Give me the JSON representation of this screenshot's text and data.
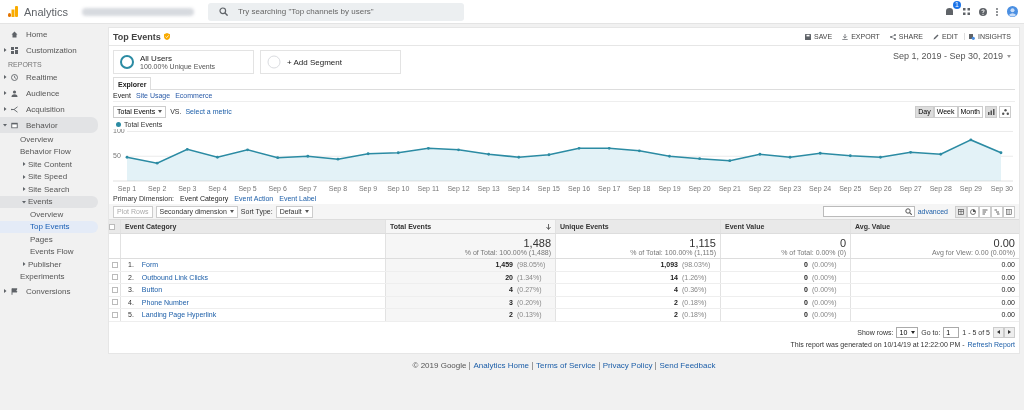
{
  "app": {
    "name": "Analytics",
    "search_placeholder": "Try searching \"Top channels by users\"",
    "notification_count": "1"
  },
  "sidebar": {
    "top_items": [
      {
        "label": "Home",
        "selected": false
      },
      {
        "label": "Customization",
        "selected": false,
        "expanded": false
      }
    ],
    "section_label": "REPORTS",
    "items": [
      {
        "label": "Realtime",
        "selected": false,
        "expanded": false
      },
      {
        "label": "Audience",
        "selected": false,
        "expanded": false
      },
      {
        "label": "Acquisition",
        "selected": false,
        "expanded": false
      },
      {
        "label": "Behavior",
        "selected": false,
        "expanded": true,
        "children": [
          {
            "label": "Overview",
            "selected": false
          },
          {
            "label": "Behavior Flow",
            "selected": false
          },
          {
            "label": "Site Content",
            "selected": false,
            "expanded": false
          },
          {
            "label": "Site Speed",
            "selected": false,
            "expanded": false
          },
          {
            "label": "Site Search",
            "selected": false,
            "expanded": false
          },
          {
            "label": "Events",
            "selected": false,
            "expanded": true,
            "children": [
              {
                "label": "Overview",
                "selected": false
              },
              {
                "label": "Top Events",
                "selected": true
              },
              {
                "label": "Pages",
                "selected": false
              },
              {
                "label": "Events Flow",
                "selected": false
              }
            ]
          },
          {
            "label": "Publisher",
            "selected": false,
            "expanded": false
          },
          {
            "label": "Experiments",
            "selected": false
          }
        ]
      },
      {
        "label": "Conversions",
        "selected": false,
        "expanded": false
      }
    ]
  },
  "report": {
    "title": "Top Events",
    "actions": [
      "SAVE",
      "EXPORT",
      "SHARE",
      "EDIT",
      "INSIGHTS"
    ],
    "date_range": "Sep 1, 2019 - Sep 30, 2019"
  },
  "segments": [
    {
      "name": "All Users",
      "detail": "100.00% Unique Events",
      "active": true
    },
    {
      "name": "+ Add Segment",
      "active": false
    }
  ],
  "tabs": [
    {
      "label": "Explorer",
      "selected": true
    }
  ],
  "subtabs": [
    {
      "label": "Event",
      "selected": true
    },
    {
      "label": "Site Usage",
      "selected": false
    },
    {
      "label": "Ecommerce",
      "selected": false
    }
  ],
  "chart_controls": {
    "metric": "Total Events",
    "vs": "VS.",
    "select_metric": "Select a metric",
    "periods": [
      {
        "label": "Day",
        "selected": true
      },
      {
        "label": "Week",
        "selected": false
      },
      {
        "label": "Month",
        "selected": false
      }
    ]
  },
  "chart": {
    "chart_data": {
      "type": "area",
      "categories": [
        "Sep 1",
        "Sep 2",
        "Sep 3",
        "Sep 4",
        "Sep 5",
        "Sep 6",
        "Sep 7",
        "Sep 8",
        "Sep 9",
        "Sep 10",
        "Sep 11",
        "Sep 12",
        "Sep 13",
        "Sep 14",
        "Sep 15",
        "Sep 16",
        "Sep 17",
        "Sep 18",
        "Sep 19",
        "Sep 20",
        "Sep 21",
        "Sep 22",
        "Sep 23",
        "Sep 24",
        "Sep 25",
        "Sep 26",
        "Sep 27",
        "Sep 28",
        "Sep 29",
        "Sep 30"
      ],
      "ylim": [
        0,
        105
      ],
      "yticks": [
        50,
        100
      ],
      "series": [
        {
          "name": "Total Events",
          "color": "#2b8ba3",
          "values": [
            48,
            36,
            64,
            48,
            63,
            47,
            50,
            44,
            55,
            57,
            66,
            63,
            54,
            48,
            53,
            66,
            66,
            61,
            50,
            45,
            41,
            54,
            48,
            56,
            51,
            48,
            58,
            54,
            83,
            57
          ]
        }
      ]
    }
  },
  "dimensions": {
    "label": "Primary Dimension:",
    "options": [
      {
        "label": "Event Category",
        "selected": true
      },
      {
        "label": "Event Action",
        "selected": false
      },
      {
        "label": "Event Label",
        "selected": false
      }
    ]
  },
  "toolbar": {
    "plot_rows": "Plot Rows",
    "secondary": "Secondary dimension",
    "sort_label": "Sort Type:",
    "sort_value": "Default",
    "advanced": "advanced"
  },
  "table": {
    "select_all_checked": false,
    "columns": [
      "Event Category",
      "Total Events",
      "Unique Events",
      "Event Value",
      "Avg. Value"
    ],
    "totals": [
      {
        "value": "1,488",
        "note": "% of Total: 100.00% (1,488)"
      },
      {
        "value": "1,115",
        "note": "% of Total: 100.00% (1,115)"
      },
      {
        "value": "0",
        "note": "% of Total: 0.00% (0)"
      },
      {
        "value": "0.00",
        "note": "Avg for View: 0.00 (0.00%)"
      }
    ],
    "rows": [
      {
        "index": "1.",
        "category": "Form",
        "checked": false,
        "total": "1,459",
        "total_pct": "(98.05%)",
        "unique": "1,093",
        "unique_pct": "(98.03%)",
        "value": "0",
        "value_pct": "(0.00%)",
        "avg": "0.00"
      },
      {
        "index": "2.",
        "category": "Outbound Link Clicks",
        "checked": false,
        "total": "20",
        "total_pct": "(1.34%)",
        "unique": "14",
        "unique_pct": "(1.26%)",
        "value": "0",
        "value_pct": "(0.00%)",
        "avg": "0.00"
      },
      {
        "index": "3.",
        "category": "Button",
        "checked": false,
        "total": "4",
        "total_pct": "(0.27%)",
        "unique": "4",
        "unique_pct": "(0.36%)",
        "value": "0",
        "value_pct": "(0.00%)",
        "avg": "0.00"
      },
      {
        "index": "4.",
        "category": "Phone Number",
        "checked": false,
        "total": "3",
        "total_pct": "(0.20%)",
        "unique": "2",
        "unique_pct": "(0.18%)",
        "value": "0",
        "value_pct": "(0.00%)",
        "avg": "0.00"
      },
      {
        "index": "5.",
        "category": "Landing Page Hyperlink",
        "checked": false,
        "total": "2",
        "total_pct": "(0.13%)",
        "unique": "2",
        "unique_pct": "(0.18%)",
        "value": "0",
        "value_pct": "(0.00%)",
        "avg": "0.00"
      }
    ]
  },
  "pagination": {
    "show_rows_label": "Show rows:",
    "rows_value": "10",
    "goto_label": "Go to:",
    "goto_value": "1",
    "range": "1 - 5 of 5"
  },
  "generated": {
    "text": "This report was generated on 10/14/19 at 12:22:00 PM -",
    "link": "Refresh Report"
  },
  "footer": {
    "copyright": "© 2019 Google",
    "links": [
      "Analytics Home",
      "Terms of Service",
      "Privacy Policy",
      "Send Feedback"
    ]
  }
}
